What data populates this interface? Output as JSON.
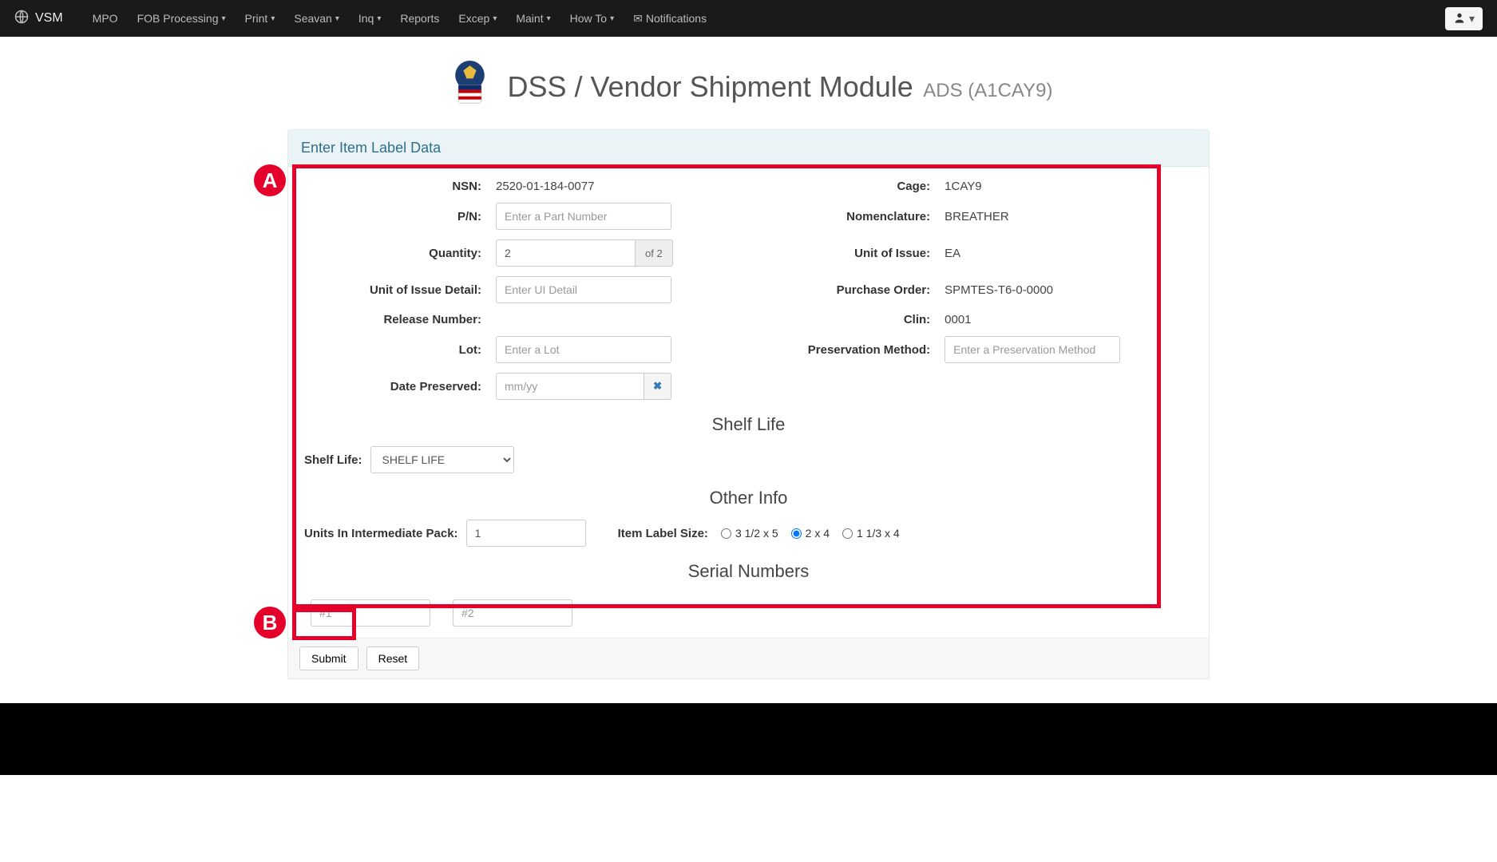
{
  "nav": {
    "brand": "VSM",
    "items": [
      {
        "label": "MPO",
        "dropdown": false
      },
      {
        "label": "FOB Processing",
        "dropdown": true
      },
      {
        "label": "Print",
        "dropdown": true
      },
      {
        "label": "Seavan",
        "dropdown": true
      },
      {
        "label": "Inq",
        "dropdown": true
      },
      {
        "label": "Reports",
        "dropdown": false
      },
      {
        "label": "Excep",
        "dropdown": true
      },
      {
        "label": "Maint",
        "dropdown": true
      },
      {
        "label": "How To",
        "dropdown": true
      },
      {
        "label": "Notifications",
        "dropdown": false,
        "icon": true
      }
    ]
  },
  "header": {
    "title": "DSS / Vendor Shipment Module",
    "sub": "ADS (A1CAY9)"
  },
  "panel": {
    "heading": "Enter Item Label Data"
  },
  "form": {
    "nsn_label": "NSN:",
    "nsn_value": "2520-01-184-0077",
    "cage_label": "Cage:",
    "cage_value": "1CAY9",
    "pn_label": "P/N:",
    "pn_placeholder": "Enter a Part Number",
    "nomen_label": "Nomenclature:",
    "nomen_value": "BREATHER",
    "qty_label": "Quantity:",
    "qty_value": "2",
    "qty_addon": "of 2",
    "ui_label": "Unit of Issue:",
    "ui_value": "EA",
    "uid_label": "Unit of Issue Detail:",
    "uid_placeholder": "Enter UI Detail",
    "po_label": "Purchase Order:",
    "po_value": "SPMTES-T6-0-0000",
    "rel_label": "Release Number:",
    "clin_label": "Clin:",
    "clin_value": "0001",
    "lot_label": "Lot:",
    "lot_placeholder": "Enter a Lot",
    "pres_label": "Preservation Method:",
    "pres_placeholder": "Enter a Preservation Method",
    "date_label": "Date Preserved:",
    "date_placeholder": "mm/yy"
  },
  "shelf": {
    "heading": "Shelf Life",
    "label": "Shelf Life:",
    "value": "SHELF LIFE"
  },
  "other": {
    "heading": "Other Info",
    "units_label": "Units In Intermediate Pack:",
    "units_value": "1",
    "size_label": "Item Label Size:",
    "opts": [
      "3 1/2 x 5",
      "2 x 4",
      "1 1/3 x 4"
    ]
  },
  "serial": {
    "heading": "Serial Numbers",
    "ph1": "#1",
    "ph2": "#2"
  },
  "buttons": {
    "submit": "Submit",
    "reset": "Reset"
  },
  "badges": {
    "a": "A",
    "b": "B"
  }
}
